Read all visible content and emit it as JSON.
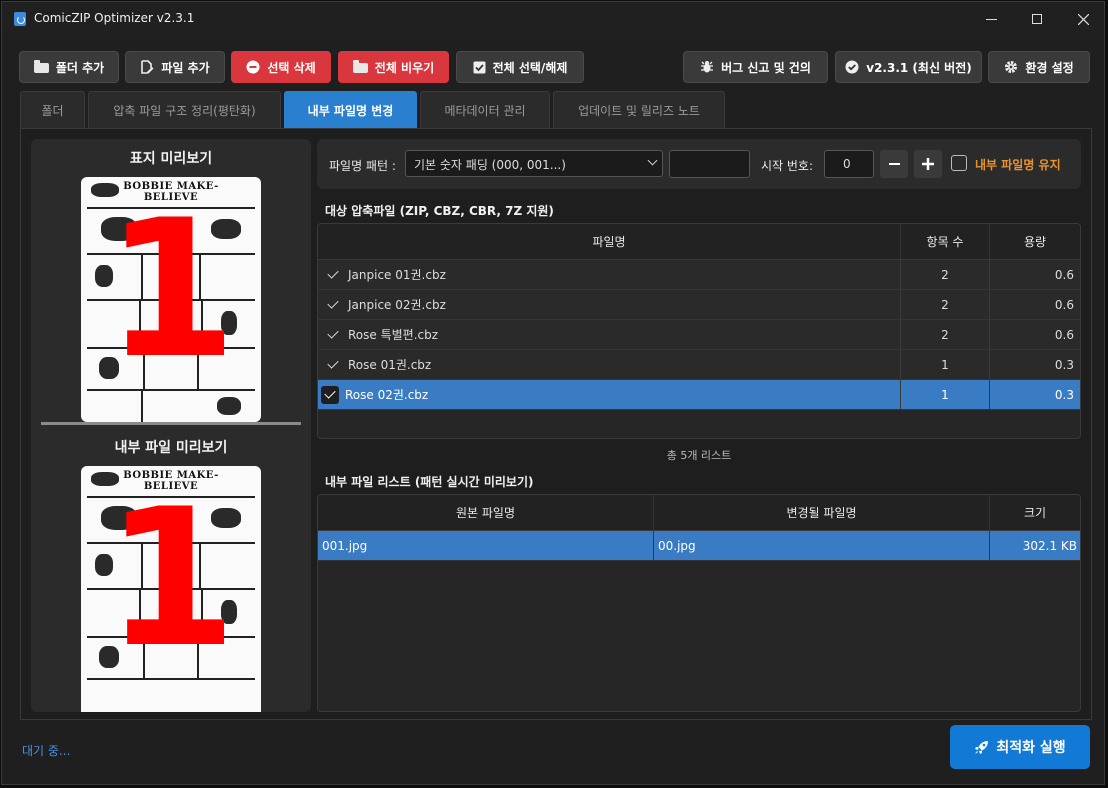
{
  "window": {
    "title": "ComicZIP Optimizer v2.3.1"
  },
  "toolbar": {
    "add_folder": "폴더 추가",
    "add_file": "파일 추가",
    "delete_selected": "선택 삭제",
    "clear_all": "전체 비우기",
    "toggle_select_all": "전체 선택/해제",
    "bug_report": "버그 신고 및 건의",
    "version": "v2.3.1 (최신 버전)",
    "settings": "환경 설정"
  },
  "tabs": [
    {
      "label": "폴더",
      "active": false
    },
    {
      "label": "압축 파일 구조 정리(평탄화)",
      "active": false
    },
    {
      "label": "내부 파일명 변경",
      "active": true
    },
    {
      "label": "메타데이터 관리",
      "active": false
    },
    {
      "label": "업데이트 및 릴리즈 노트",
      "active": false
    }
  ],
  "preview": {
    "cover_title": "표지 미리보기",
    "inner_title": "내부 파일 미리보기",
    "cover_overlay": "1",
    "inner_overlay": "1",
    "comic_header": "BOBBIE MAKE-BELIEVE"
  },
  "pattern": {
    "label": "파일명 패턴 :",
    "selected": "기본 숫자 패딩 (000, 001...)",
    "custom_value": "",
    "start_label": "시작 번호:",
    "start_value": "0",
    "minus": "−",
    "plus": "+",
    "keep_label": "내부 파일명 유지"
  },
  "archives": {
    "title": "대상 압축파일 (ZIP, CBZ, CBR, 7Z 지원)",
    "headers": [
      "파일명",
      "항목 수",
      "용량"
    ],
    "rows": [
      {
        "name": "Janpice 01권.cbz",
        "count": "2",
        "size": "0.6",
        "selected": false
      },
      {
        "name": "Janpice 02권.cbz",
        "count": "2",
        "size": "0.6",
        "selected": false
      },
      {
        "name": "Rose 특별편.cbz",
        "count": "2",
        "size": "0.6",
        "selected": false
      },
      {
        "name": "Rose 01권.cbz",
        "count": "1",
        "size": "0.3",
        "selected": false
      },
      {
        "name": "Rose 02권.cbz",
        "count": "1",
        "size": "0.3",
        "selected": true
      }
    ],
    "total": "총 5개 리스트"
  },
  "inner_files": {
    "title": "내부 파일 리스트 (패턴 실시간 미리보기)",
    "headers": [
      "원본 파일명",
      "변경될 파일명",
      "크기"
    ],
    "rows": [
      {
        "original": "001.jpg",
        "renamed": "00.jpg",
        "size": "302.1 KB"
      }
    ]
  },
  "status": {
    "text": "대기 중..."
  },
  "run_button": {
    "label": "최적화 실행"
  },
  "colors": {
    "accent": "#2a7fcf",
    "danger": "#d9363e",
    "run": "#1279d6",
    "overlay": "#ff0000",
    "warning_label": "#e8932e"
  }
}
